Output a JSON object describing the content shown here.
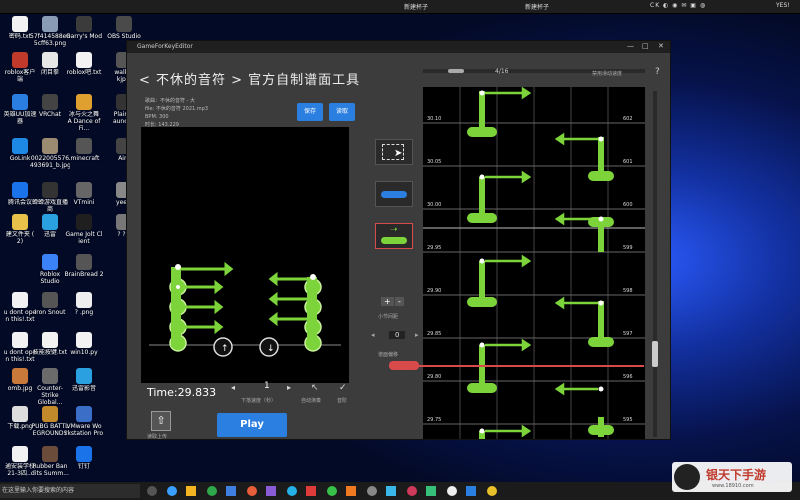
{
  "topbar": {
    "item1": "新建杯子",
    "item2": "新建杯子",
    "item3": "YES!",
    "tray": "CK ◐ ◉ ✉ ▣ ◍"
  },
  "desktop_icons": [
    {
      "label": "密码.txt"
    },
    {
      "label": "57f414588e8\n5cff63.png"
    },
    {
      "label": "Garry's Mod"
    },
    {
      "label": "OBS Studio"
    },
    {
      "label": "roblox客户\n端"
    },
    {
      "label": "闭目拳"
    },
    {
      "label": "roblox吧.txt"
    },
    {
      "label": "walkin\nkjplv"
    },
    {
      "label": "英雄UU加速\n器"
    },
    {
      "label": "VRChat"
    },
    {
      "label": "冰与火之舞\nA Dance of Fi..."
    },
    {
      "label": "Plain C\naunche"
    },
    {
      "label": "GoLink"
    },
    {
      "label": "0022005576\n493691_b.jpg"
    },
    {
      "label": ".minecraft"
    },
    {
      "label": "Aim"
    },
    {
      "label": "腾讯会议"
    },
    {
      "label": "蝉蝉游戏直播\n商"
    },
    {
      "label": "VTmini"
    },
    {
      "label": "yee~"
    },
    {
      "label": "建文件夹 (\n2)"
    },
    {
      "label": "迅雷"
    },
    {
      "label": "Game Jolt Cl\nient"
    },
    {
      "label": "? ? ?"
    },
    {
      "label": "Roblox Studio"
    },
    {
      "label": "BrainBread 2"
    },
    {
      "label": "u dont ope\nn this!.txt"
    },
    {
      "label": "Iron Snout"
    },
    {
      "label": "? .png"
    },
    {
      "label": "u dont ope\nn this!.txt"
    },
    {
      "label": "技能按键.txt"
    },
    {
      "label": "win10.py"
    },
    {
      "label": "omb.jpg"
    },
    {
      "label": "Counter-Strike Global..."
    },
    {
      "label": "迅雷影音"
    },
    {
      "label": "下载.png"
    },
    {
      "label": "PUBG BATTL\nEGROUNDS"
    },
    {
      "label": "VMware Wo\nrkstation Pro"
    },
    {
      "label": "通安装学校\n21-3四..."
    },
    {
      "label": "Rubber Ban\ndits Summ..."
    },
    {
      "label": "钉钉"
    }
  ],
  "window": {
    "title": "GameForKeyEditor",
    "header": "< 不休的音符 > 官方自制谱面工具",
    "info_song": "歌曲：不休的音符 - 大",
    "info_file": "file: 不休的音符 2021.mp3",
    "bpm": "BPM: 300",
    "duration": "时长: 143.229",
    "save_label": "保存",
    "read_label": "读取",
    "time_text": "Time:29.833",
    "speed_value": "1",
    "speed_label": "下落速度（秒）",
    "auto_label": "自动演奏",
    "check_label": "音阶",
    "import_label": "读取上传",
    "play_label": "Play",
    "page_indicator": "4/16",
    "top_right_label": "禁用滑动速度",
    "help": "?",
    "small_measure_label": "小节间距",
    "note_move_label": "谱面偏移",
    "stepper_value": "0",
    "plus": "+",
    "minus": "-",
    "chart_rows": [
      {
        "time": "30.10",
        "num": "602"
      },
      {
        "time": "30.05",
        "num": "601"
      },
      {
        "time": "30.00",
        "num": "600"
      },
      {
        "time": "29.95",
        "num": "599"
      },
      {
        "time": "29.90",
        "num": "598"
      },
      {
        "time": "29.85",
        "num": "597"
      },
      {
        "time": "29.80",
        "num": "596"
      },
      {
        "time": "29.75",
        "num": "595"
      }
    ]
  },
  "taskbar": {
    "search_placeholder": "在这里输入你要搜索的内容"
  },
  "watermark": {
    "text": "银天下手游",
    "url": "www.18910.com"
  },
  "colors": {
    "accent_blue": "#2b7fe0",
    "note_green": "#7dd43a",
    "red_line": "#d94a4a"
  }
}
